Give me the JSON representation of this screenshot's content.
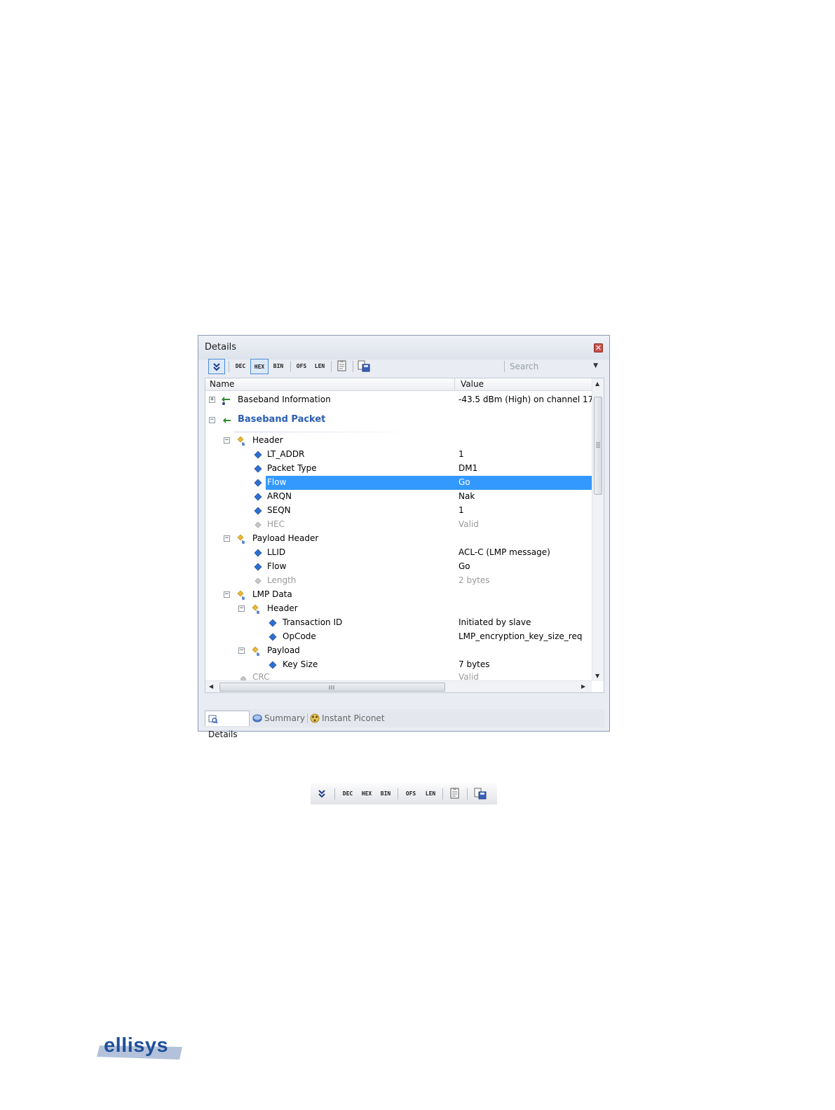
{
  "panel": {
    "title": "Details",
    "toolbar": {
      "decode_labels": [
        "DEC",
        "HEX",
        "BIN"
      ],
      "offset_labels": [
        "OFS",
        "LEN"
      ],
      "active_format": "HEX",
      "search_placeholder": "Search"
    },
    "columns": {
      "name": "Name",
      "value": "Value"
    },
    "rows": [
      {
        "name": "Baseband Information",
        "value": "-43.5 dBm (High) on channel 17",
        "expander": "+",
        "icon": "green-arrow-icon"
      },
      {
        "name": "Baseband Packet",
        "value": "",
        "expander": "−",
        "icon": "green-arrow-icon"
      },
      {
        "name": "Header",
        "value": "",
        "expander": "−",
        "icon": "group-icon"
      },
      {
        "name": "LT_ADDR",
        "value": "1",
        "icon": "blue-diamond-icon"
      },
      {
        "name": "Packet Type",
        "value": "DM1",
        "icon": "blue-diamond-icon"
      },
      {
        "name": "Flow",
        "value": "Go",
        "icon": "blue-diamond-icon",
        "selected": true
      },
      {
        "name": "ARQN",
        "value": "Nak",
        "icon": "blue-diamond-icon"
      },
      {
        "name": "SEQN",
        "value": "1",
        "icon": "blue-diamond-icon"
      },
      {
        "name": "HEC",
        "value": "Valid",
        "icon": "gray-diamond-icon"
      },
      {
        "name": "Payload Header",
        "value": "",
        "expander": "−",
        "icon": "group-icon"
      },
      {
        "name": "LLID",
        "value": "ACL-C (LMP message)",
        "icon": "blue-diamond-icon"
      },
      {
        "name": "Flow",
        "value": "Go",
        "icon": "blue-diamond-icon"
      },
      {
        "name": "Length",
        "value": "2 bytes",
        "icon": "gray-diamond-icon"
      },
      {
        "name": "LMP Data",
        "value": "",
        "expander": "−",
        "icon": "group-icon"
      },
      {
        "name": "Header",
        "value": "",
        "expander": "−",
        "icon": "group-icon"
      },
      {
        "name": "Transaction ID",
        "value": "Initiated by slave",
        "icon": "blue-diamond-icon"
      },
      {
        "name": "OpCode",
        "value": "LMP_encryption_key_size_req",
        "icon": "blue-diamond-icon"
      },
      {
        "name": "Payload",
        "value": "",
        "expander": "−",
        "icon": "group-icon"
      },
      {
        "name": "Key Size",
        "value": "7 bytes",
        "icon": "blue-diamond-icon"
      },
      {
        "name": "CRC",
        "value": "Valid",
        "icon": "gray-diamond-icon"
      }
    ],
    "tabs": [
      {
        "label": "Details",
        "icon": "details-icon",
        "active": true
      },
      {
        "label": "Summary",
        "icon": "summary-icon",
        "active": false
      },
      {
        "label": "Instant Piconet",
        "icon": "piconet-icon",
        "active": false
      }
    ],
    "colors": {
      "selection": "#3399ff",
      "accent": "#2a5db0"
    }
  },
  "standalone_toolbar": {
    "decode_labels": [
      "DEC",
      "HEX",
      "BIN"
    ],
    "offset_labels": [
      "OFS",
      "LEN"
    ]
  },
  "logo": {
    "text": "ellisys"
  }
}
